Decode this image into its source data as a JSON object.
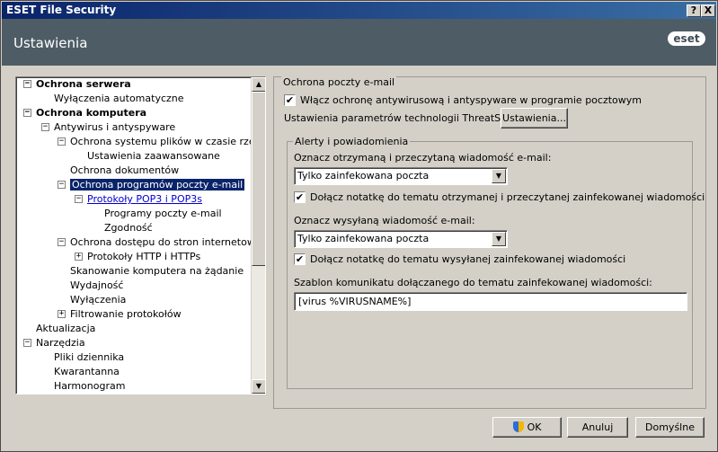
{
  "window": {
    "title": "ESET File Security",
    "help_btn": "?",
    "close_btn": "X"
  },
  "header": {
    "title": "Ustawienia",
    "logo": "eset"
  },
  "tree": {
    "items": [
      {
        "label": "Ochrona serwera",
        "exp": "−"
      },
      {
        "label": "Wyłączenia automatyczne"
      },
      {
        "label": "Ochrona komputera",
        "exp": "−"
      },
      {
        "label": "Antywirus i antyspyware",
        "exp": "−"
      },
      {
        "label": "Ochrona systemu plików w czasie rzeczywistym",
        "exp": "−"
      },
      {
        "label": "Ustawienia zaawansowane"
      },
      {
        "label": "Ochrona dokumentów"
      },
      {
        "label": "Ochrona programów poczty e-mail",
        "exp": "−"
      },
      {
        "label": "Protokoły POP3 i POP3s",
        "exp": "−"
      },
      {
        "label": "Programy poczty e-mail"
      },
      {
        "label": "Zgodność"
      },
      {
        "label": "Ochrona dostępu do stron internetowych",
        "exp": "−"
      },
      {
        "label": "Protokoły HTTP i HTTPs",
        "exp": "+"
      },
      {
        "label": "Skanowanie komputera na żądanie"
      },
      {
        "label": "Wydajność"
      },
      {
        "label": "Wyłączenia"
      },
      {
        "label": "Filtrowanie protokołów",
        "exp": "+"
      },
      {
        "label": "Aktualizacja"
      },
      {
        "label": "Narzędzia",
        "exp": "−"
      },
      {
        "label": "Pliki dziennika"
      },
      {
        "label": "Kwarantanna"
      },
      {
        "label": "Harmonogram"
      }
    ],
    "scroll_up": "▲",
    "scroll_down": "▼"
  },
  "panel": {
    "title": "Ochrona poczty e-mail",
    "enable_checkbox_label": "Włącz ochronę antywirusową i antyspyware w programie pocztowym",
    "enable_checked": true,
    "threatsense_label": "Ustawienia parametrów technologii ThreatSense:",
    "threatsense_button": "Ustawienia...",
    "alerts": {
      "title": "Alerty i powiadomienia",
      "received_label": "Oznacz otrzymaną i przeczytaną wiadomość e-mail:",
      "received_select": "Tylko zainfekowana poczta",
      "received_note_label": "Dołącz notatkę do tematu otrzymanej i przeczytanej zainfekowanej wiadomości",
      "received_note_checked": true,
      "sent_label": "Oznacz wysyłaną wiadomość e-mail:",
      "sent_select": "Tylko zainfekowana poczta",
      "sent_note_label": "Dołącz notatkę do tematu wysyłanej zainfekowanej wiadomości",
      "sent_note_checked": true,
      "template_label": "Szablon komunikatu dołączanego do tematu zainfekowanej wiadomości:",
      "template_value": "[virus %VIRUSNAME%]"
    }
  },
  "footer": {
    "ok": "OK",
    "cancel": "Anuluj",
    "default": "Domyślne"
  },
  "checkmark": "✔",
  "arrow_down": "▼"
}
